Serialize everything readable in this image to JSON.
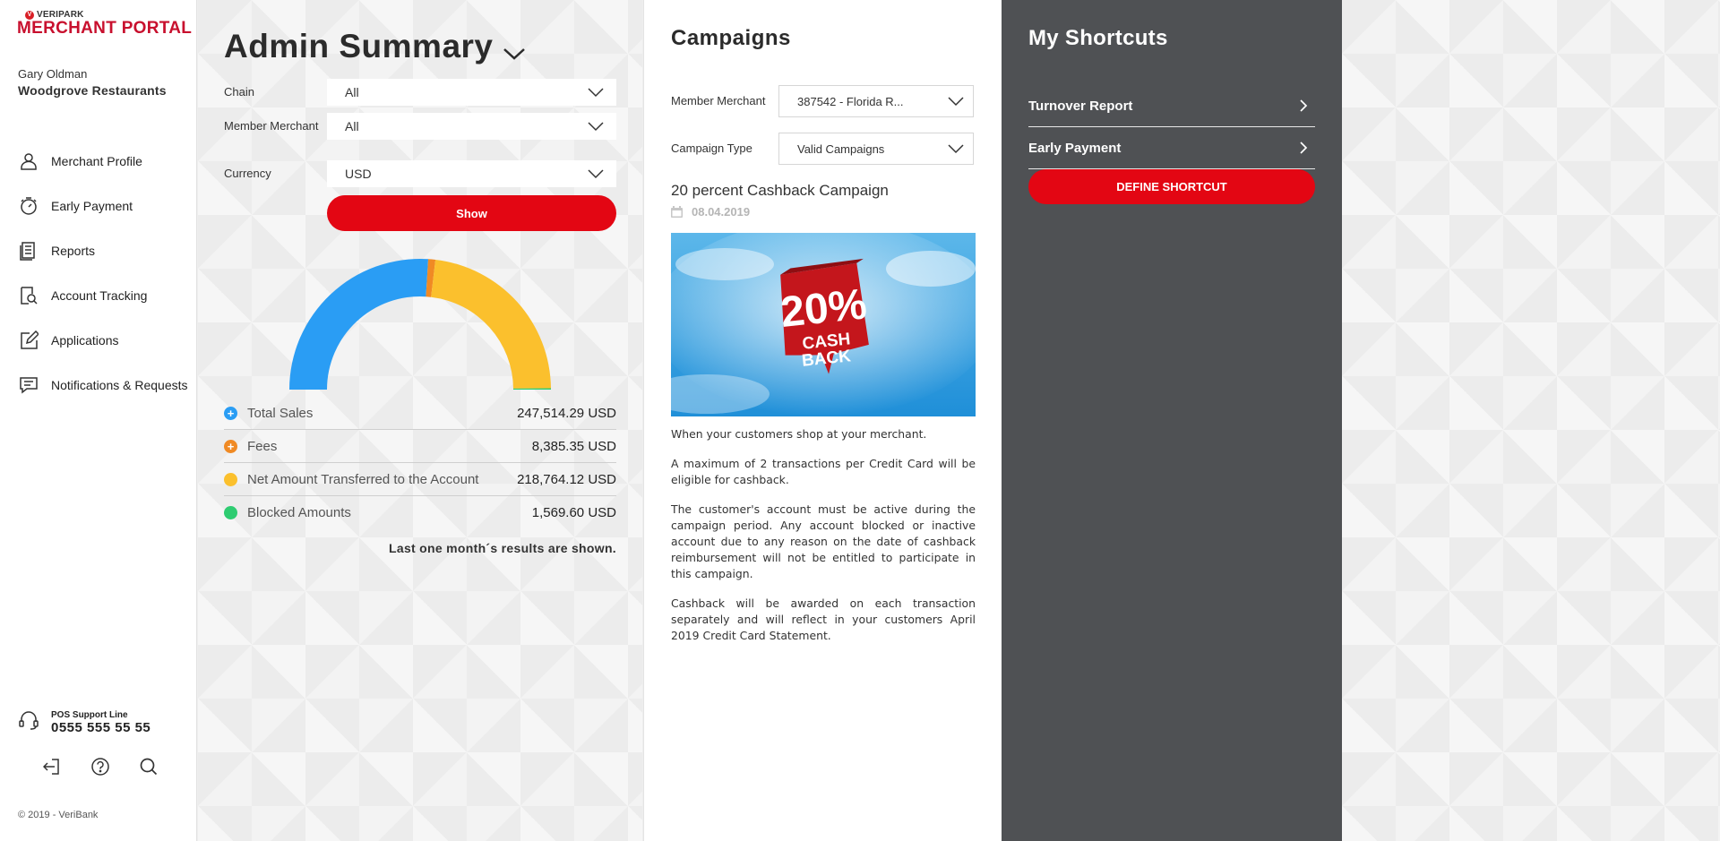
{
  "brand": {
    "small": "VERIPARK",
    "big": "MERCHANT PORTAL",
    "logo_letter": "V",
    "accent": "#e30613"
  },
  "user": {
    "name": "Gary Oldman",
    "company": "Woodgrove Restaurants"
  },
  "nav": [
    {
      "label": "Merchant Profile",
      "icon": "user-icon"
    },
    {
      "label": "Early Payment",
      "icon": "stopwatch-icon"
    },
    {
      "label": "Reports",
      "icon": "document-icon"
    },
    {
      "label": "Account Tracking",
      "icon": "search-document-icon"
    },
    {
      "label": "Applications",
      "icon": "edit-icon"
    },
    {
      "label": "Notifications & Requests",
      "icon": "chat-icon"
    }
  ],
  "support": {
    "label": "POS Support Line",
    "phone": "0555 555 55 55"
  },
  "copyright": "© 2019 - VeriBank",
  "admin": {
    "title": "Admin Summary",
    "filters": [
      {
        "label": "Chain",
        "value": "All"
      },
      {
        "label": "Member Merchant",
        "value": "All"
      },
      {
        "label": "Currency",
        "value": "USD"
      }
    ],
    "show_label": "Show",
    "legend": [
      {
        "label": "Total Sales",
        "value": "247,514.29 USD",
        "color": "#2a9df4",
        "marker": "+"
      },
      {
        "label": "Fees",
        "value": "8,385.35 USD",
        "color": "#f08a24",
        "marker": "+"
      },
      {
        "label": "Net Amount Transferred to the Account",
        "value": "218,764.12 USD",
        "color": "#fbc02d",
        "marker": ""
      },
      {
        "label": "Blocked Amounts",
        "value": "1,569.60 USD",
        "color": "#2ecc71",
        "marker": ""
      }
    ],
    "note": "Last one month´s results are shown."
  },
  "chart_data": {
    "type": "pie",
    "variant": "half-donut",
    "categories": [
      "Total Sales",
      "Fees",
      "Net Amount Transferred to the Account",
      "Blocked Amounts"
    ],
    "values": [
      247514.29,
      8385.35,
      218764.12,
      1569.6
    ],
    "colors": [
      "#2a9df4",
      "#f08a24",
      "#fbc02d",
      "#2ecc71"
    ],
    "unit": "USD"
  },
  "campaigns": {
    "title": "Campaigns",
    "member_label": "Member Merchant",
    "member_value": "387542 - Florida R...",
    "type_label": "Campaign Type",
    "type_value": "Valid Campaigns",
    "name": "20 percent Cashback Campaign",
    "date": "08.04.2019",
    "image": {
      "big": "20%",
      "sub1": "CASH",
      "sub2": "BACK"
    },
    "paragraphs": [
      "When your customers shop at your merchant.",
      "A maximum of 2 transactions per Credit Card will be eligible for cashback.",
      "The customer's account must be active during the campaign period. Any account blocked or inactive account due to any reason on the date of cashback reimbursement will not be entitled to participate in this campaign.",
      "Cashback will be awarded on each transaction separately and will reflect in your customers April 2019 Credit Card Statement."
    ]
  },
  "shortcuts": {
    "title": "My Shortcuts",
    "items": [
      "Turnover Report",
      "Early Payment"
    ],
    "define_label": "DEFINE SHORTCUT"
  }
}
